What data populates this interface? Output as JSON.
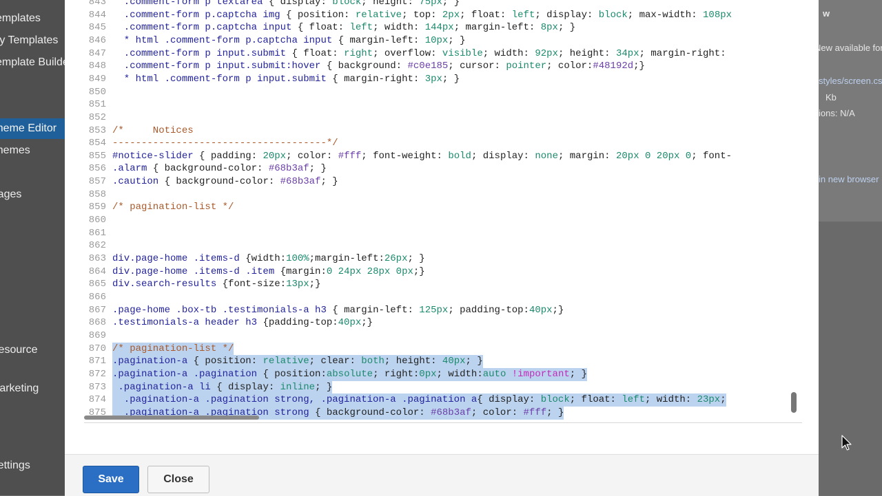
{
  "sidebar": {
    "items": [
      {
        "label": "Templates",
        "active": false
      },
      {
        "label": "My Templates",
        "active": false
      },
      {
        "label": "Template Builders",
        "active": false
      },
      {
        "label": "",
        "active": false
      },
      {
        "label": "Theme Editor",
        "active": true
      },
      {
        "label": "Themes",
        "active": false
      },
      {
        "label": "",
        "active": false
      },
      {
        "label": "Pages",
        "active": false
      },
      {
        "label": "Resource",
        "active": false
      },
      {
        "label": "Marketing",
        "active": false
      },
      {
        "label": "Settings",
        "active": false
      }
    ]
  },
  "right_panel": {
    "lines": [
      {
        "text": "w",
        "style": "bold"
      },
      {
        "text": "New available for",
        "style": "normal"
      },
      {
        "text": "styles/screen.css",
        "style": "link"
      },
      {
        "text": "Kb",
        "style": "normal"
      },
      {
        "text": "ions: N/A",
        "style": "normal"
      },
      {
        "text": "in new browser",
        "style": "link"
      }
    ]
  },
  "editor": {
    "lines": [
      {
        "num": "843",
        "selected": false,
        "tokens": [
          [
            "sel",
            "  .comment-form p textarea "
          ],
          [
            "prop",
            "{ display: "
          ],
          [
            "val",
            "block"
          ],
          [
            "prop",
            "; height: "
          ],
          [
            "val",
            "75px"
          ],
          [
            "prop",
            "; }"
          ]
        ]
      },
      {
        "num": "844",
        "selected": false,
        "tokens": [
          [
            "sel",
            "  .comment-form p.captcha img "
          ],
          [
            "prop",
            "{ position: "
          ],
          [
            "val",
            "relative"
          ],
          [
            "prop",
            "; top: "
          ],
          [
            "val",
            "2px"
          ],
          [
            "prop",
            "; float: "
          ],
          [
            "val",
            "left"
          ],
          [
            "prop",
            "; display: "
          ],
          [
            "val",
            "block"
          ],
          [
            "prop",
            "; max-width: "
          ],
          [
            "val",
            "108px"
          ]
        ]
      },
      {
        "num": "845",
        "selected": false,
        "tokens": [
          [
            "sel",
            "  .comment-form p.captcha input "
          ],
          [
            "prop",
            "{ float: "
          ],
          [
            "val",
            "left"
          ],
          [
            "prop",
            "; width: "
          ],
          [
            "val",
            "144px"
          ],
          [
            "prop",
            "; margin-left: "
          ],
          [
            "val",
            "8px"
          ],
          [
            "prop",
            "; }"
          ]
        ]
      },
      {
        "num": "846",
        "selected": false,
        "tokens": [
          [
            "sel",
            "  * html .comment-form p.captcha input "
          ],
          [
            "prop",
            "{ margin-left: "
          ],
          [
            "val",
            "10px"
          ],
          [
            "prop",
            "; }"
          ]
        ]
      },
      {
        "num": "847",
        "selected": false,
        "tokens": [
          [
            "sel",
            "  .comment-form p input.submit "
          ],
          [
            "prop",
            "{ float: "
          ],
          [
            "val",
            "right"
          ],
          [
            "prop",
            "; overflow: "
          ],
          [
            "val",
            "visible"
          ],
          [
            "prop",
            "; width: "
          ],
          [
            "val",
            "92px"
          ],
          [
            "prop",
            "; height: "
          ],
          [
            "val",
            "34px"
          ],
          [
            "prop",
            "; margin-right:"
          ]
        ]
      },
      {
        "num": "848",
        "selected": false,
        "tokens": [
          [
            "sel",
            "  .comment-form p input.submit:hover "
          ],
          [
            "prop",
            "{ background: "
          ],
          [
            "hex",
            "#c0e185"
          ],
          [
            "prop",
            "; cursor: "
          ],
          [
            "val",
            "pointer"
          ],
          [
            "prop",
            "; color:"
          ],
          [
            "hex",
            "#48192d"
          ],
          [
            "prop",
            ";}"
          ]
        ]
      },
      {
        "num": "849",
        "selected": false,
        "tokens": [
          [
            "sel",
            "  * html .comment-form p input.submit "
          ],
          [
            "prop",
            "{ margin-right: "
          ],
          [
            "val",
            "3px"
          ],
          [
            "prop",
            "; }"
          ]
        ]
      },
      {
        "num": "850",
        "selected": false,
        "tokens": []
      },
      {
        "num": "851",
        "selected": false,
        "tokens": []
      },
      {
        "num": "852",
        "selected": false,
        "tokens": []
      },
      {
        "num": "853",
        "selected": false,
        "tokens": [
          [
            "cmt",
            "/*     Notices"
          ]
        ]
      },
      {
        "num": "854",
        "selected": false,
        "tokens": [
          [
            "cmt",
            "-------------------------------------*/"
          ]
        ]
      },
      {
        "num": "855",
        "selected": false,
        "tokens": [
          [
            "sel",
            "#notice-slider "
          ],
          [
            "prop",
            "{ padding: "
          ],
          [
            "val",
            "20px"
          ],
          [
            "prop",
            "; color: "
          ],
          [
            "hex",
            "#fff"
          ],
          [
            "prop",
            "; font-weight: "
          ],
          [
            "val",
            "bold"
          ],
          [
            "prop",
            "; display: "
          ],
          [
            "val",
            "none"
          ],
          [
            "prop",
            "; margin: "
          ],
          [
            "val",
            "20px 0 20px 0"
          ],
          [
            "prop",
            "; font-"
          ]
        ]
      },
      {
        "num": "856",
        "selected": false,
        "tokens": [
          [
            "sel",
            ".alarm "
          ],
          [
            "prop",
            "{ background-color: "
          ],
          [
            "hex",
            "#68b3af"
          ],
          [
            "prop",
            "; }"
          ]
        ]
      },
      {
        "num": "857",
        "selected": false,
        "tokens": [
          [
            "sel",
            ".caution "
          ],
          [
            "prop",
            "{ background-color: "
          ],
          [
            "hex",
            "#68b3af"
          ],
          [
            "prop",
            "; }"
          ]
        ]
      },
      {
        "num": "858",
        "selected": false,
        "tokens": []
      },
      {
        "num": "859",
        "selected": false,
        "tokens": [
          [
            "cmt",
            "/* pagination-list */"
          ]
        ]
      },
      {
        "num": "860",
        "selected": false,
        "tokens": []
      },
      {
        "num": "861",
        "selected": false,
        "tokens": []
      },
      {
        "num": "862",
        "selected": false,
        "tokens": []
      },
      {
        "num": "863",
        "selected": false,
        "tokens": [
          [
            "sel",
            "div.page-home .items-d "
          ],
          [
            "prop",
            "{width:"
          ],
          [
            "val",
            "100%"
          ],
          [
            "prop",
            ";margin-left:"
          ],
          [
            "val",
            "26px"
          ],
          [
            "prop",
            "; }"
          ]
        ]
      },
      {
        "num": "864",
        "selected": false,
        "tokens": [
          [
            "sel",
            "div.page-home .items-d .item "
          ],
          [
            "prop",
            "{margin:"
          ],
          [
            "val",
            "0 24px 28px 0px"
          ],
          [
            "prop",
            ";}"
          ]
        ]
      },
      {
        "num": "865",
        "selected": false,
        "tokens": [
          [
            "sel",
            "div.search-results "
          ],
          [
            "prop",
            "{font-size:"
          ],
          [
            "val",
            "13px"
          ],
          [
            "prop",
            ";}"
          ]
        ]
      },
      {
        "num": "866",
        "selected": false,
        "tokens": []
      },
      {
        "num": "867",
        "selected": false,
        "tokens": [
          [
            "sel",
            ".page-home .box-tb .testimonials-a h3 "
          ],
          [
            "prop",
            "{ margin-left: "
          ],
          [
            "val",
            "125px"
          ],
          [
            "prop",
            "; padding-top:"
          ],
          [
            "val",
            "40px"
          ],
          [
            "prop",
            ";}"
          ]
        ]
      },
      {
        "num": "868",
        "selected": false,
        "tokens": [
          [
            "sel",
            ".testimonials-a header h3 "
          ],
          [
            "prop",
            "{padding-top:"
          ],
          [
            "val",
            "40px"
          ],
          [
            "prop",
            ";}"
          ]
        ]
      },
      {
        "num": "869",
        "selected": false,
        "tokens": []
      },
      {
        "num": "870",
        "selected": true,
        "tokens": [
          [
            "cmt",
            "/* pagination-list */"
          ]
        ]
      },
      {
        "num": "871",
        "selected": true,
        "tokens": [
          [
            "sel",
            ".pagination-a "
          ],
          [
            "prop",
            "{ position: "
          ],
          [
            "val",
            "relative"
          ],
          [
            "prop",
            "; clear: "
          ],
          [
            "val",
            "both"
          ],
          [
            "prop",
            "; height: "
          ],
          [
            "val",
            "40px"
          ],
          [
            "prop",
            "; }"
          ]
        ]
      },
      {
        "num": "872",
        "selected": true,
        "tokens": [
          [
            "sel",
            ".pagination-a .pagination "
          ],
          [
            "prop",
            "{ position:"
          ],
          [
            "val",
            "absolute"
          ],
          [
            "prop",
            "; right:"
          ],
          [
            "val",
            "0px"
          ],
          [
            "prop",
            "; width:"
          ],
          [
            "val",
            "auto "
          ],
          [
            "imp",
            "!important"
          ],
          [
            "prop",
            "; }"
          ]
        ]
      },
      {
        "num": "873",
        "selected": true,
        "tokens": [
          [
            "sel",
            " .pagination-a li "
          ],
          [
            "prop",
            "{ display: "
          ],
          [
            "val",
            "inline"
          ],
          [
            "prop",
            "; }"
          ]
        ]
      },
      {
        "num": "874",
        "selected": true,
        "tokens": [
          [
            "sel",
            "  .pagination-a .pagination strong, .pagination-a .pagination a"
          ],
          [
            "prop",
            "{ display: "
          ],
          [
            "val",
            "block"
          ],
          [
            "prop",
            "; float: "
          ],
          [
            "val",
            "left"
          ],
          [
            "prop",
            "; width: "
          ],
          [
            "val",
            "23px"
          ],
          [
            "prop",
            ";"
          ]
        ]
      },
      {
        "num": "875",
        "selected": true,
        "tokens": [
          [
            "sel",
            "  .pagination-a .pagination strong "
          ],
          [
            "prop",
            "{ background-color: "
          ],
          [
            "hex",
            "#68b3af"
          ],
          [
            "prop",
            "; color: "
          ],
          [
            "hex",
            "#fff"
          ],
          [
            "prop",
            "; }"
          ]
        ]
      }
    ]
  },
  "footer": {
    "save_label": "Save",
    "close_label": "Close"
  },
  "colors": {
    "primary_button": "#2a6fc4",
    "selection": "#bcd3ef",
    "sidebar_active": "#1f5f9a"
  }
}
